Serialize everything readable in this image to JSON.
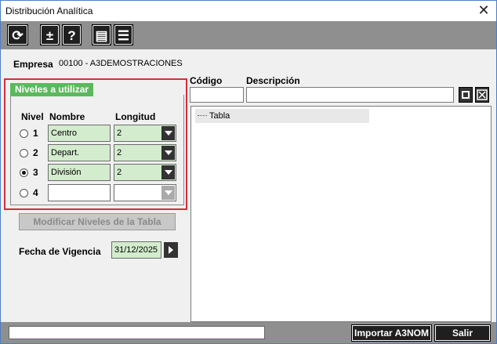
{
  "window": {
    "title": "Distribución Analítica",
    "close_glyph": "✕"
  },
  "toolbar": {
    "buttons": [
      {
        "icon": "refresh-icon",
        "glyph": "⟳"
      },
      {
        "icon": "plus-minus-icon",
        "glyph": "±"
      },
      {
        "icon": "help-icon",
        "glyph": "?"
      },
      {
        "icon": "print-icon",
        "glyph": "▤"
      },
      {
        "icon": "list-icon",
        "glyph": "☰"
      }
    ]
  },
  "empresa": {
    "label": "Empresa",
    "value": "00100 - A3DEMOSTRACIONES"
  },
  "niveles": {
    "tab_label": "Niveles a utilizar",
    "headers": {
      "nivel": "Nivel",
      "nombre": "Nombre",
      "longitud": "Longitud"
    },
    "rows": [
      {
        "num": "1",
        "name": "Centro",
        "length": "2",
        "checked": false
      },
      {
        "num": "2",
        "name": "Depart.",
        "length": "2",
        "checked": false
      },
      {
        "num": "3",
        "name": "División",
        "length": "2",
        "checked": true
      },
      {
        "num": "4",
        "name": "",
        "length": "",
        "checked": false
      }
    ]
  },
  "modificar_button": "Modificar Niveles de la Tabla",
  "fecha": {
    "label": "Fecha de Vigencia",
    "value": "31/12/2025"
  },
  "search": {
    "codigo_label": "Código",
    "descripcion_label": "Descripción"
  },
  "tree": {
    "root": "Tabla"
  },
  "footer": {
    "importar": "Importar A3NOM",
    "salir": "Salir"
  },
  "colors": {
    "accent_red": "#d32f3a",
    "tab_green": "#5cb85c",
    "field_green": "#d3eccd",
    "toolbar_gray": "#8f8f8f"
  }
}
